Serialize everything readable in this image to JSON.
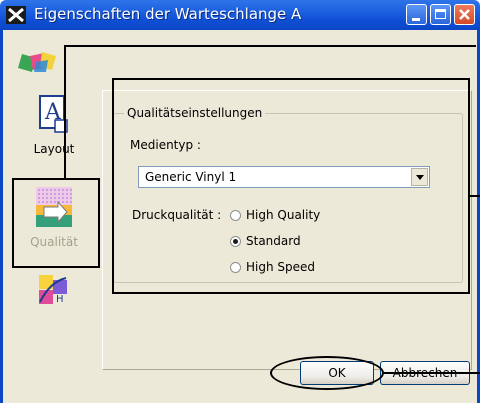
{
  "window": {
    "title": "Eigenschaften der Warteschlange A"
  },
  "nav": {
    "items": [
      {
        "label": "Layout",
        "icon": "layout-icon",
        "enabled": true
      },
      {
        "label": "Qualität",
        "icon": "quality-icon",
        "enabled": false,
        "selected": true
      },
      {
        "label": "",
        "icon": "color-adjust-icon",
        "enabled": true
      }
    ]
  },
  "quality": {
    "group_title": "Qualitätseinstellungen",
    "media_type_label": "Medientyp :",
    "media_type_value": "Generic Vinyl 1",
    "print_quality_label": "Druckqualität :",
    "options": [
      {
        "label": "High Quality",
        "selected": false
      },
      {
        "label": "Standard",
        "selected": true
      },
      {
        "label": "High Speed",
        "selected": false
      }
    ]
  },
  "buttons": {
    "ok": "OK",
    "cancel": "Abbrechen"
  },
  "colors": {
    "titlebar": "#0b46c6",
    "window_bg": "#ece9d8"
  }
}
